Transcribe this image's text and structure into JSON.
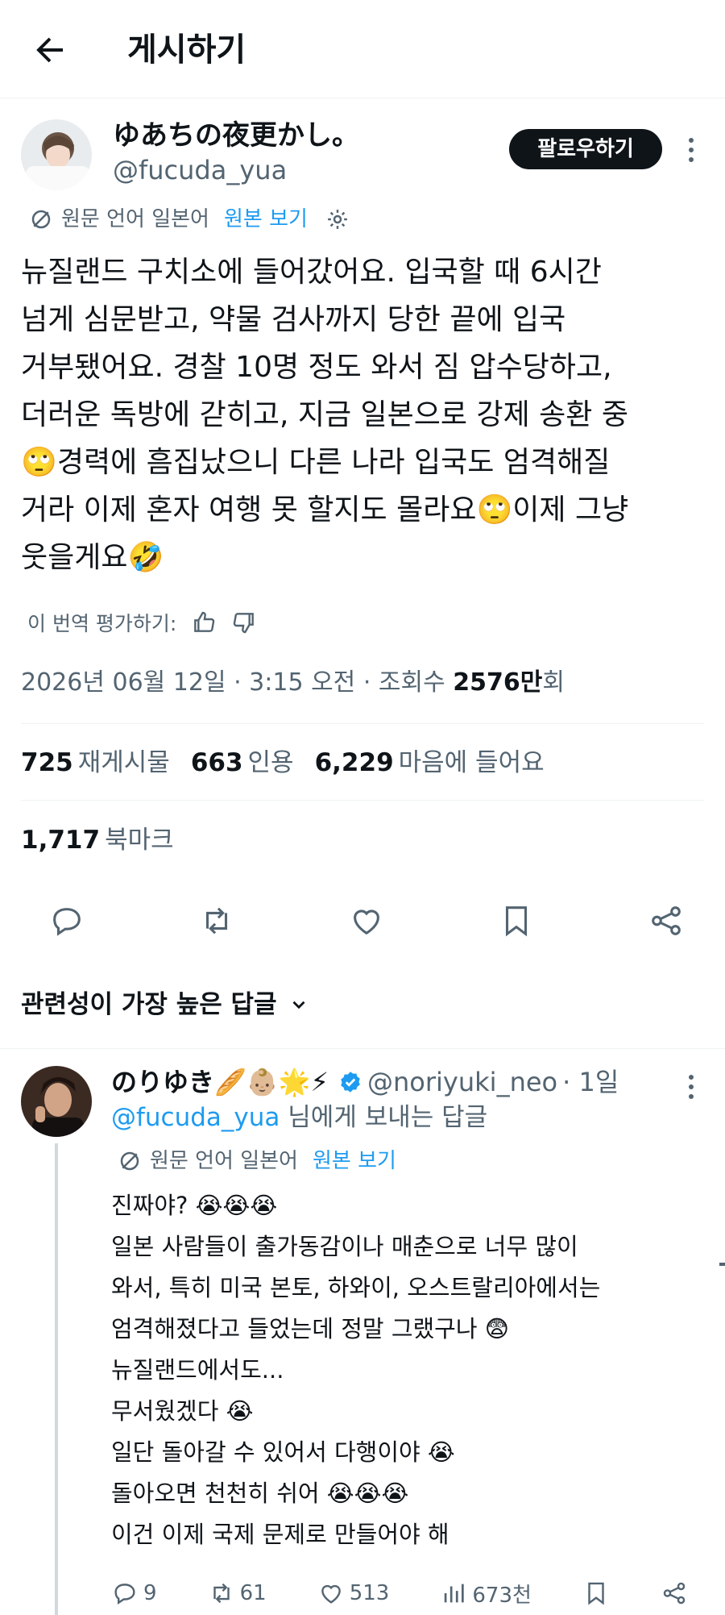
{
  "header": {
    "title": "게시하기",
    "back_icon": "arrow-left-icon"
  },
  "tweet": {
    "author_name": "ゆあちの夜更かし。",
    "author_handle": "@fucuda_yua",
    "follow_label": "팔로우하기",
    "original_lang_label": "원문 언어 일본어",
    "view_original_label": "원본 보기",
    "text_lines": [
      "뉴질랜드 구치소에 들어갔어요. 입국할 때 6시간",
      "넘게 심문받고, 약물 검사까지 당한 끝에 입국",
      "거부됐어요. 경찰 10명 정도 와서 짐 압수당하고,",
      "더러운 독방에 갇히고, 지금 일본으로 강제 송환 중",
      "🙄경력에 흠집났으니 다른 나라 입국도 엄격해질",
      "거라 이제 혼자 여행 못 할지도 몰라요🙄이제 그냥",
      "웃을게요🤣"
    ],
    "rate_label": "이 번역 평가하기:",
    "datetime": "2026년 06월 12일 · 3:15 오전 · 조회수 ",
    "views_value": "2576만",
    "views_unit": "회",
    "retweets_count": "725",
    "retweets_label": "재게시물",
    "quotes_count": "663",
    "quotes_label": "인용",
    "likes_count": "6,229",
    "likes_label": "마음에 들어요",
    "bookmarks_count": "1,717",
    "bookmarks_label": "북마크"
  },
  "sort": {
    "label": "관련성이 가장 높은 답글"
  },
  "reply": {
    "author_name": "のりゆき🥖👶🏼🌟⚡",
    "handle": "@noriyuki_neo",
    "time": "· 1일",
    "reply_to_handle": "@fucuda_yua",
    "reply_to_suffix": " 님에게 보내는 답글",
    "original_lang_label": "원문 언어 일본어",
    "view_original_label": "원본 보기",
    "text_lines": [
      "진짜야? 😭😭😭",
      "일본 사람들이 출가동감이나 매춘으로 너무 많이",
      "와서, 특히 미국 본토, 하와이, 오스트랄리아에서는",
      "엄격해졌다고 들었는데 정말 그랬구나 😨",
      "뉴질랜드에서도...",
      "무서웠겠다 😭",
      "일단 돌아갈 수 있어서 다행이야 😭",
      "돌아오면 천천히 쉬어 😭😭😭",
      "이건 이제 국제 문제로 만들어야 해"
    ],
    "replies": "9",
    "retweets": "61",
    "likes": "513",
    "views": "673천"
  },
  "colors": {
    "accent": "#1d9bf0",
    "text": "#0f1419",
    "muted": "#536471",
    "divider": "#eff3f4"
  }
}
